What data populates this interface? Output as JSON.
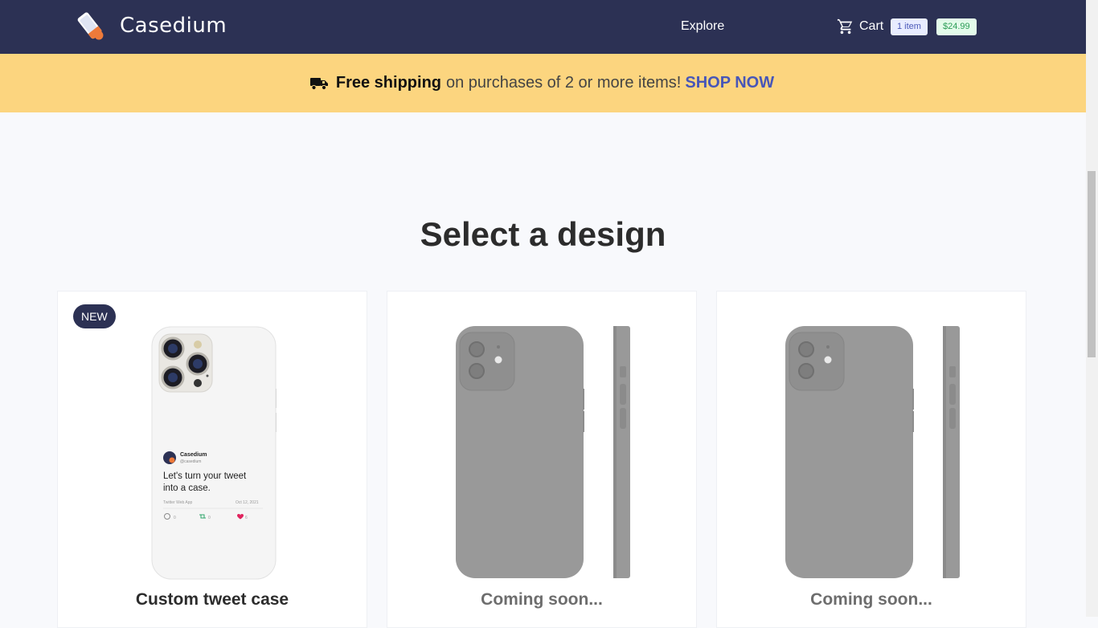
{
  "header": {
    "brand": "Casedium",
    "nav_explore": "Explore",
    "cart_label": "Cart",
    "cart_items_badge": "1 item",
    "cart_total_badge": "$24.99"
  },
  "promo": {
    "strong": "Free shipping",
    "text": "on purchases of 2 or more items!",
    "link": "SHOP NOW"
  },
  "main": {
    "title": "Select a design",
    "cards": [
      {
        "badge": "NEW",
        "title": "Custom tweet case",
        "tweet": {
          "name": "Casedium",
          "handle": "@casedium",
          "text_line1": "Let's turn your tweet",
          "text_line2": "into a case.",
          "source": "Twitter Web App",
          "date": "Oct 12, 2021",
          "replies": "0",
          "retweets": "0",
          "likes": "6"
        }
      },
      {
        "title": "Coming soon..."
      },
      {
        "title": "Coming soon..."
      }
    ]
  },
  "colors": {
    "header_bg": "#2c3154",
    "promo_bg": "#fcd57f",
    "accent": "#4756b8",
    "page_bg": "#f8f9fc"
  }
}
